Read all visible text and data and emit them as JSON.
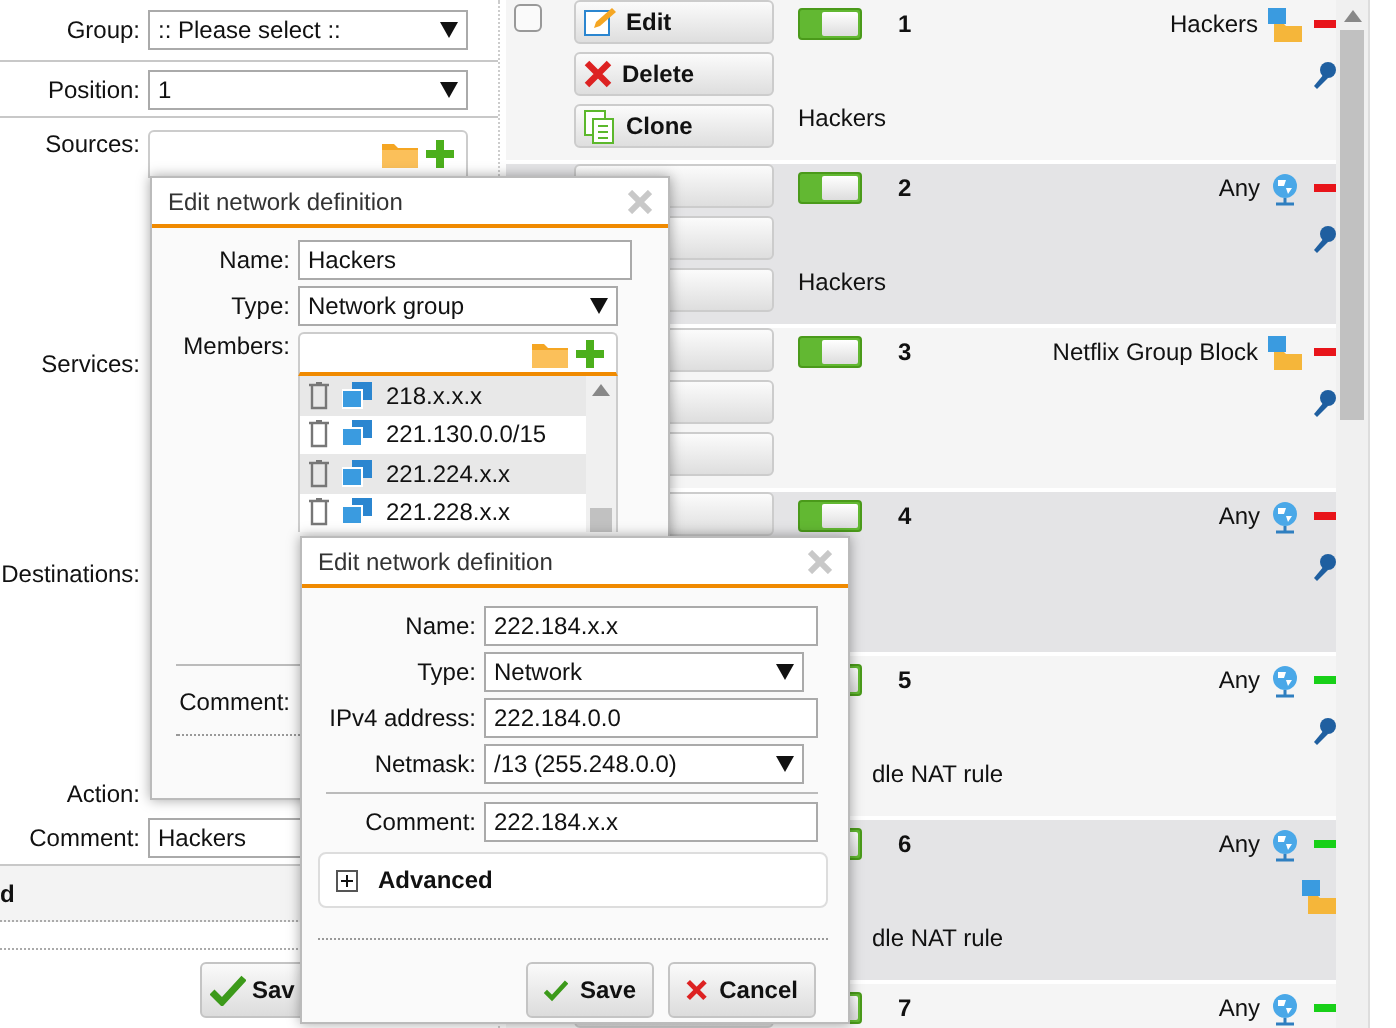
{
  "form": {
    "fields": [
      {
        "kind": "select",
        "label": "Group:",
        "value": ":: Please select ::"
      },
      {
        "kind": "select",
        "label": "Position:",
        "value": "1"
      },
      {
        "kind": "picker",
        "label": "Sources:"
      },
      {
        "kind": "label",
        "label": "Services:"
      },
      {
        "kind": "label",
        "label": "Destinations:"
      },
      {
        "kind": "label",
        "label": "Action:"
      },
      {
        "kind": "text",
        "label": "Comment:",
        "value": "Hackers"
      }
    ],
    "section_heading": "d",
    "save_button": "Sav"
  },
  "rules": {
    "rows": [
      {
        "number": "1",
        "checked": false,
        "enabled": true,
        "actions": [
          {
            "kind": "edit",
            "label": "Edit"
          },
          {
            "kind": "delete",
            "label": "Delete"
          },
          {
            "kind": "clone",
            "label": "Clone"
          }
        ],
        "comment": "Hackers",
        "source": {
          "kind": "group",
          "text": "Hackers"
        },
        "color": "#e8141a",
        "extra": {
          "kind": "key"
        }
      },
      {
        "number": "2",
        "enabled": true,
        "comment": "Hackers",
        "source": {
          "kind": "any",
          "text": "Any"
        },
        "color": "#e8141a",
        "extra": {
          "kind": "key"
        }
      },
      {
        "number": "3",
        "enabled": true,
        "source": {
          "kind": "group",
          "text": "Netflix Group Block"
        },
        "color": "#e8141a",
        "extra": {
          "kind": "key"
        }
      },
      {
        "number": "4",
        "enabled": true,
        "source": {
          "kind": "any",
          "text": "Any"
        },
        "color": "#e8141a",
        "extra": {
          "kind": "key"
        }
      },
      {
        "number": "5",
        "enabled": true,
        "comment": "dle NAT rule",
        "comment_partly_covered": true,
        "source": {
          "kind": "any",
          "text": "Any"
        },
        "color": "#18d018",
        "extra": {
          "kind": "key"
        }
      },
      {
        "number": "6",
        "enabled": true,
        "comment": "dle NAT rule",
        "comment_partly_covered": true,
        "source": {
          "kind": "any",
          "text": "Any"
        },
        "color": "#18d018",
        "extra": {
          "kind": "network"
        }
      },
      {
        "number": "7",
        "enabled": true,
        "source": {
          "kind": "any",
          "text": "Any"
        },
        "color": "#18d018"
      }
    ]
  },
  "group_dialog": {
    "title": "Edit network definition",
    "name_label": "Name:",
    "name": "Hackers",
    "type_label": "Type:",
    "type": "Network group",
    "members_label": "Members:",
    "members": [
      "218.x.x.x",
      "221.130.0.0/15",
      "221.224.x.x",
      "221.228.x.x"
    ],
    "comment_label": "Comment:"
  },
  "network_dialog": {
    "title": "Edit network definition",
    "fields": [
      {
        "kind": "text",
        "label": "Name:",
        "value": "222.184.x.x"
      },
      {
        "kind": "select",
        "label": "Type:",
        "value": "Network"
      },
      {
        "kind": "text",
        "label": "IPv4 address:",
        "value": "222.184.0.0"
      },
      {
        "kind": "select",
        "label": "Netmask:",
        "value": "/13 (255.248.0.0)"
      },
      {
        "kind": "text",
        "label": "Comment:",
        "value": "222.184.x.x",
        "separated": true
      }
    ],
    "advanced": {
      "label": "Advanced",
      "expanded": false
    },
    "buttons": [
      {
        "kind": "save",
        "label": "Save"
      },
      {
        "kind": "cancel",
        "label": "Cancel"
      }
    ]
  }
}
